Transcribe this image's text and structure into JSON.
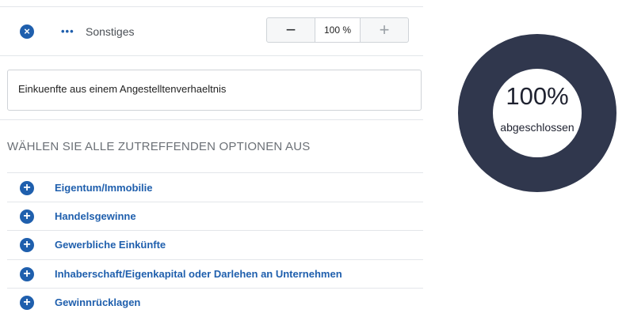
{
  "selected_item": {
    "label": "Sonstiges",
    "remove_icon": "close-icon",
    "dots_icon": "more-dots-icon",
    "stepper": {
      "minus": "−",
      "value": "100 %",
      "plus": "+"
    }
  },
  "description": "Einkuenfte aus einem Angestelltenverhaeltnis",
  "section_heading": "WÄHLEN SIE ALLE ZUTREFFENDEN OPTIONEN AUS",
  "options": [
    {
      "label": "Eigentum/Immobilie"
    },
    {
      "label": "Handelsgewinne"
    },
    {
      "label": "Gewerbliche Einkünfte"
    },
    {
      "label": "Inhaberschaft/Eigenkapital oder Darlehen an Unternehmen"
    },
    {
      "label": "Gewinnrücklagen"
    }
  ],
  "progress": {
    "percent_text": "100%",
    "status": "abgeschlossen",
    "fraction": 1.0,
    "ring_color": "#30374d"
  },
  "colors": {
    "accent": "#1f5fad",
    "divider": "#e3e6ea"
  }
}
